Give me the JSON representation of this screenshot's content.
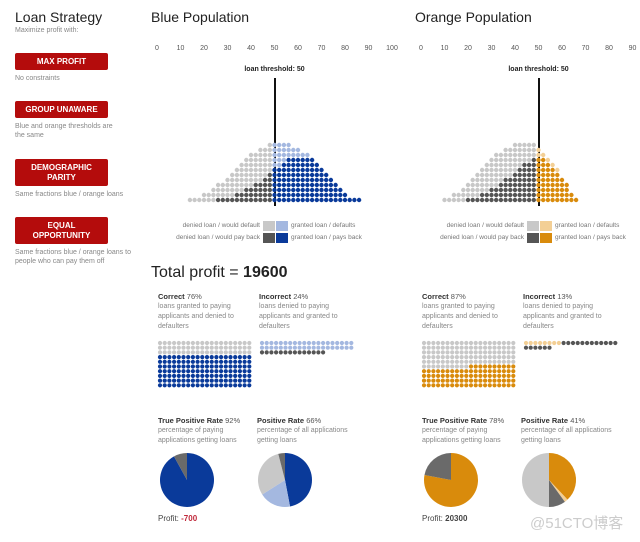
{
  "sidebar": {
    "title": "Loan Strategy",
    "subtitle": "Maximize profit with:",
    "strategies": [
      {
        "label": "MAX PROFIT",
        "desc": "No constraints"
      },
      {
        "label": "GROUP UNAWARE",
        "desc": "Blue and orange thresholds are the same"
      },
      {
        "label": "DEMOGRAPHIC PARITY",
        "desc": "Same fractions blue / orange loans"
      },
      {
        "label": "EQUAL OPPORTUNITY",
        "desc": "Same fractions blue / orange loans to people who can pay them off"
      }
    ]
  },
  "colors": {
    "accent": "#b40c0c",
    "blue": "#0a3a9a",
    "light_blue": "#a4b8e0",
    "orange": "#d98b0c",
    "light_orange": "#f3cf95",
    "dark_gray": "#555555",
    "light_gray": "#c8c8c8",
    "profit_negative": "#c0283a"
  },
  "blue": {
    "title": "Population",
    "title_prefix": "Blue",
    "ticks": [
      "0",
      "10",
      "20",
      "30",
      "40",
      "50",
      "60",
      "70",
      "80",
      "90",
      "100"
    ],
    "threshold_label": "loan threshold: 50",
    "threshold": 50,
    "columns_start": 14,
    "column_totals": [
      1,
      1,
      1,
      2,
      2,
      3,
      4,
      4,
      5,
      6,
      7,
      8,
      9,
      10,
      10,
      11,
      11,
      12,
      12,
      12,
      12,
      12,
      11,
      11,
      10,
      10,
      9,
      8,
      7,
      6,
      5,
      4,
      3,
      2,
      1,
      1,
      1
    ],
    "column_payers": [
      0,
      0,
      0,
      0,
      0,
      0,
      1,
      1,
      1,
      1,
      2,
      2,
      3,
      3,
      4,
      4,
      5,
      6,
      7,
      7,
      8,
      9,
      9,
      9,
      9,
      9,
      9,
      8,
      7,
      6,
      5,
      4,
      3,
      2,
      1,
      1,
      1
    ],
    "correct": {
      "label": "Correct",
      "pct": "76%",
      "desc": "loans granted to paying applicants and denied to defaulters",
      "waffle": {
        "light": 60,
        "main": 140
      }
    },
    "incorrect": {
      "label": "Incorrect",
      "pct": "24%",
      "desc": "loans denied to paying applicants and granted to defaulters",
      "waffle": {
        "light": 40,
        "dark": 14
      }
    },
    "tpr": {
      "label": "True Positive Rate",
      "pct": "92%",
      "desc": "percentage of paying applications getting loans",
      "slices": [
        92,
        8
      ]
    },
    "pr": {
      "label": "Positive Rate",
      "pct": "66%",
      "desc": "percentage of all applications getting loans",
      "slices": [
        47,
        19,
        30,
        4
      ]
    },
    "profit_label": "Profit:",
    "profit": "-700"
  },
  "orange": {
    "title": "Population",
    "title_prefix": "Orange",
    "ticks": [
      "0",
      "10",
      "20",
      "30",
      "40",
      "50",
      "60",
      "70",
      "80",
      "90"
    ],
    "threshold_label": "loan threshold: 50",
    "threshold": 50,
    "columns_start": 10,
    "column_totals": [
      1,
      1,
      2,
      2,
      3,
      4,
      5,
      6,
      7,
      8,
      9,
      10,
      10,
      11,
      11,
      12,
      12,
      12,
      12,
      12,
      11,
      10,
      9,
      8,
      7,
      5,
      4,
      2,
      1
    ],
    "column_payers": [
      0,
      0,
      0,
      0,
      0,
      1,
      1,
      1,
      2,
      2,
      3,
      3,
      4,
      5,
      5,
      6,
      7,
      8,
      8,
      9,
      9,
      9,
      8,
      7,
      6,
      5,
      4,
      2,
      1
    ],
    "correct": {
      "label": "Correct",
      "pct": "87%",
      "desc": "loans granted to paying applicants and denied to defaulters",
      "waffle": {
        "light": 110,
        "main": 90
      }
    },
    "incorrect": {
      "label": "Incorrect",
      "pct": "13%",
      "desc": "loans denied to paying applicants and granted to defaulters",
      "waffle": {
        "light": 8,
        "dark": 18
      }
    },
    "tpr": {
      "label": "True Positive Rate",
      "pct": "78%",
      "desc": "percentage of paying applications getting loans",
      "slices": [
        78,
        22
      ]
    },
    "pr": {
      "label": "Positive Rate",
      "pct": "41%",
      "desc": "percentage of all applications getting loans",
      "slices": [
        38,
        2,
        10,
        50
      ]
    },
    "profit_label": "Profit:",
    "profit": "20300"
  },
  "legend": {
    "denied_default": "denied loan / would default",
    "denied_pay": "denied loan / would pay back",
    "granted_default": "granted loan / defaults",
    "granted_pay": "granted loan / pays back"
  },
  "total": {
    "label": "Total profit = ",
    "value": "19600"
  },
  "watermark": "@51CTO博客"
}
